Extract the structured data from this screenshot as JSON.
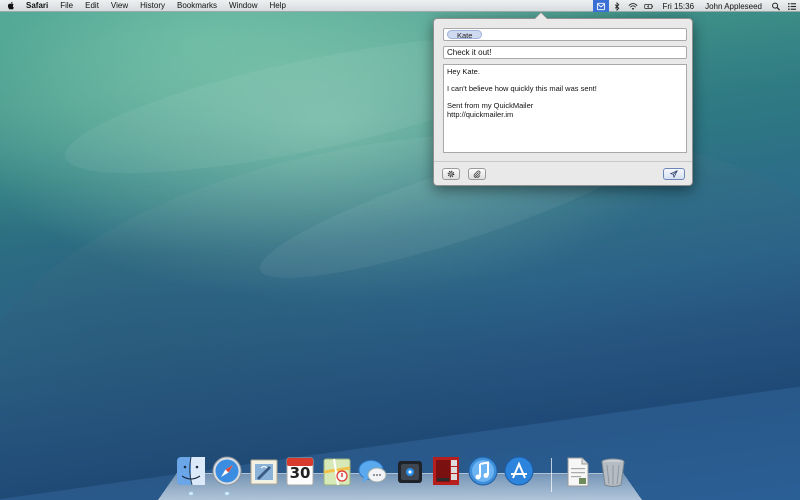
{
  "menubar": {
    "app_name": "Safari",
    "menus": [
      "File",
      "Edit",
      "View",
      "History",
      "Bookmarks",
      "Window",
      "Help"
    ],
    "clock": "Fri 15:36",
    "user": "John Appleseed",
    "status_icons": [
      "quickmailer-icon",
      "bluetooth-icon",
      "wifi-icon",
      "battery-icon",
      "search-icon",
      "list-icon"
    ]
  },
  "compose": {
    "to_token": "Kate",
    "subject": "Check it out!",
    "body_lines": [
      "Hey Kate.",
      "",
      "I can't believe how quickly this mail was sent!",
      "",
      "Sent from my QuickMailer",
      "http://quickmailer.im"
    ]
  },
  "dock": {
    "items": [
      {
        "name": "finder-icon",
        "running": true
      },
      {
        "name": "safari-icon",
        "running": true
      },
      {
        "name": "mail-icon",
        "running": false
      },
      {
        "name": "calendar-icon",
        "running": false,
        "label": "30"
      },
      {
        "name": "maps-icon",
        "running": false
      },
      {
        "name": "messages-icon",
        "running": false
      },
      {
        "name": "facetime-icon",
        "running": false
      },
      {
        "name": "photo-booth-icon",
        "running": false
      },
      {
        "name": "itunes-icon",
        "running": false
      },
      {
        "name": "app-store-icon",
        "running": false
      },
      {
        "name": "document-icon",
        "running": false
      },
      {
        "name": "trash-icon",
        "running": false
      }
    ]
  },
  "colors": {
    "menu_highlight": "#3a6fd6",
    "token_bg": "#cfd9ef"
  }
}
